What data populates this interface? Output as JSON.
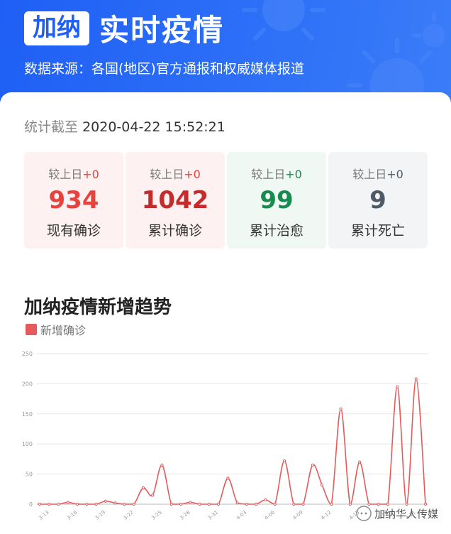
{
  "header": {
    "country": "加纳",
    "title": "实时疫情",
    "source": "数据来源：各国(地区)官方通报和权威媒体报道"
  },
  "update": {
    "prefix": "统计截至",
    "timestamp": "2020-04-22 15:52:21"
  },
  "stats": [
    {
      "delta_label": "较上日",
      "delta": "+0",
      "value": "934",
      "label": "现有确诊",
      "color": "#e8423f",
      "delta_color": "#e8423f",
      "bg": "#fdf1f1"
    },
    {
      "delta_label": "较上日",
      "delta": "+0",
      "value": "1042",
      "label": "累计确诊",
      "color": "#c52b2b",
      "delta_color": "#e8423f",
      "bg": "#fdf1f1"
    },
    {
      "delta_label": "较上日",
      "delta": "+0",
      "value": "99",
      "label": "累计治愈",
      "color": "#178b50",
      "delta_color": "#178b50",
      "bg": "#f0f8f3"
    },
    {
      "delta_label": "较上日",
      "delta": "+0",
      "value": "9",
      "label": "累计死亡",
      "color": "#4e5a65",
      "delta_color": "#4e5a65",
      "bg": "#f2f4f5"
    }
  ],
  "chart_section": {
    "title": "加纳疫情新增趋势"
  },
  "chart_data": {
    "type": "line",
    "title": "加纳疫情新增趋势",
    "series": [
      {
        "name": "新增确诊",
        "color": "#e55a5a",
        "values": [
          0,
          0,
          0,
          3,
          0,
          0,
          0,
          5,
          2,
          0,
          0,
          27,
          15,
          65,
          0,
          0,
          3,
          0,
          0,
          0,
          43,
          2,
          0,
          0,
          7,
          0,
          72,
          0,
          0,
          65,
          32,
          0,
          158,
          0,
          70,
          0,
          0,
          0,
          195,
          0,
          208,
          0
        ]
      }
    ],
    "x_start": "2020-03-12",
    "xtick_labels": [
      "3-13",
      "3-16",
      "3-19",
      "3-22",
      "3-25",
      "3-28",
      "3-31",
      "4-03",
      "4-06",
      "4-09",
      "4-12",
      "4-15",
      "4-18",
      "4-21"
    ],
    "ylim": [
      0,
      250
    ],
    "yticks": [
      0,
      50,
      100,
      150,
      200,
      250
    ],
    "grid": true,
    "legend": "top-left"
  },
  "watermark": {
    "text": "加纳华人传媒"
  },
  "colors": {
    "brand_blue": "#1f5ff5",
    "line": "#e55a5a"
  }
}
